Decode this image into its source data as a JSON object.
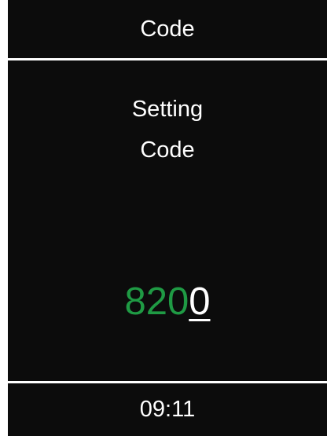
{
  "header": {
    "title": "Code"
  },
  "main": {
    "subtitle_line1": "Setting",
    "subtitle_line2": "Code",
    "code": {
      "entered": "820",
      "current_digit": "0"
    }
  },
  "footer": {
    "time": "09:11"
  },
  "colors": {
    "background": "#0c0c0c",
    "text": "#ffffff",
    "entered_digits": "#1f9a44"
  }
}
